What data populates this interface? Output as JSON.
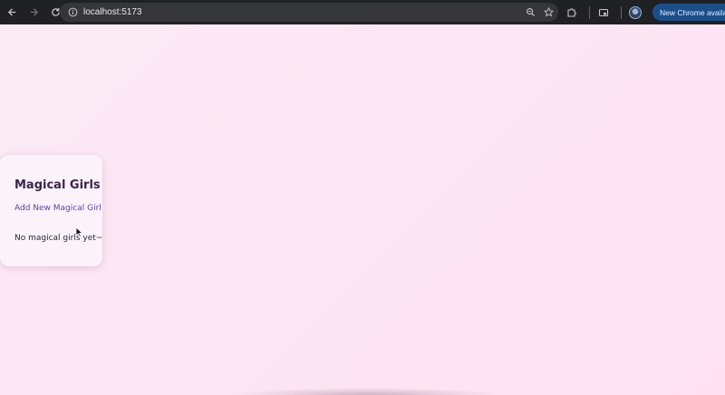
{
  "browser": {
    "url": "localhost:5173",
    "update_label": "New Chrome available",
    "icons": {
      "back": "arrow-left-icon",
      "forward": "arrow-right-icon",
      "reload": "reload-icon",
      "site_info": "info-icon",
      "zoom": "zoom-icon",
      "bookmark": "star-icon",
      "extensions": "puzzle-icon",
      "cast": "media-icon",
      "profile": "avatar-icon",
      "menu": "kebab-menu-icon"
    }
  },
  "app": {
    "title": "Magical Girls",
    "add_link": "Add New Magical Girl",
    "empty_message": "No magical girls yet~",
    "colors": {
      "background": "#fbe6f3",
      "card": "#fbf3f9",
      "link": "#5b3fb0",
      "title": "#3a2450"
    }
  }
}
